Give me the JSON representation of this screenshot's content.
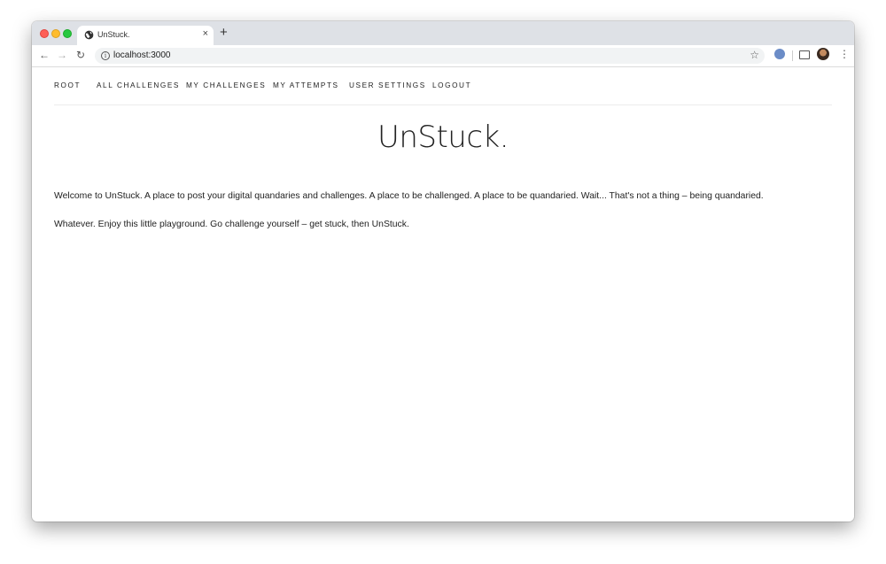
{
  "browser": {
    "tab_title": "UnStuck.",
    "url": "localhost:3000",
    "new_tab_symbol": "+",
    "close_symbol": "×",
    "colors": {
      "tabbar": "#dee1e6",
      "close_light": "#fe5f57",
      "minimize_light": "#febc2e",
      "zoom_light": "#28c840"
    }
  },
  "nav": {
    "items": [
      "ROOT",
      "ALL CHALLENGES",
      "MY CHALLENGES",
      "MY ATTEMPTS",
      "USER SETTINGS",
      "LOGOUT"
    ]
  },
  "page": {
    "title": "UnStuck.",
    "paragraphs": [
      "Welcome to UnStuck. A place to post your digital quandaries and challenges. A place to be challenged. A place to be quandaried. Wait... That's not a thing – being quandaried.",
      "Whatever. Enjoy this little playground. Go challenge yourself – get stuck, then UnStuck."
    ]
  }
}
